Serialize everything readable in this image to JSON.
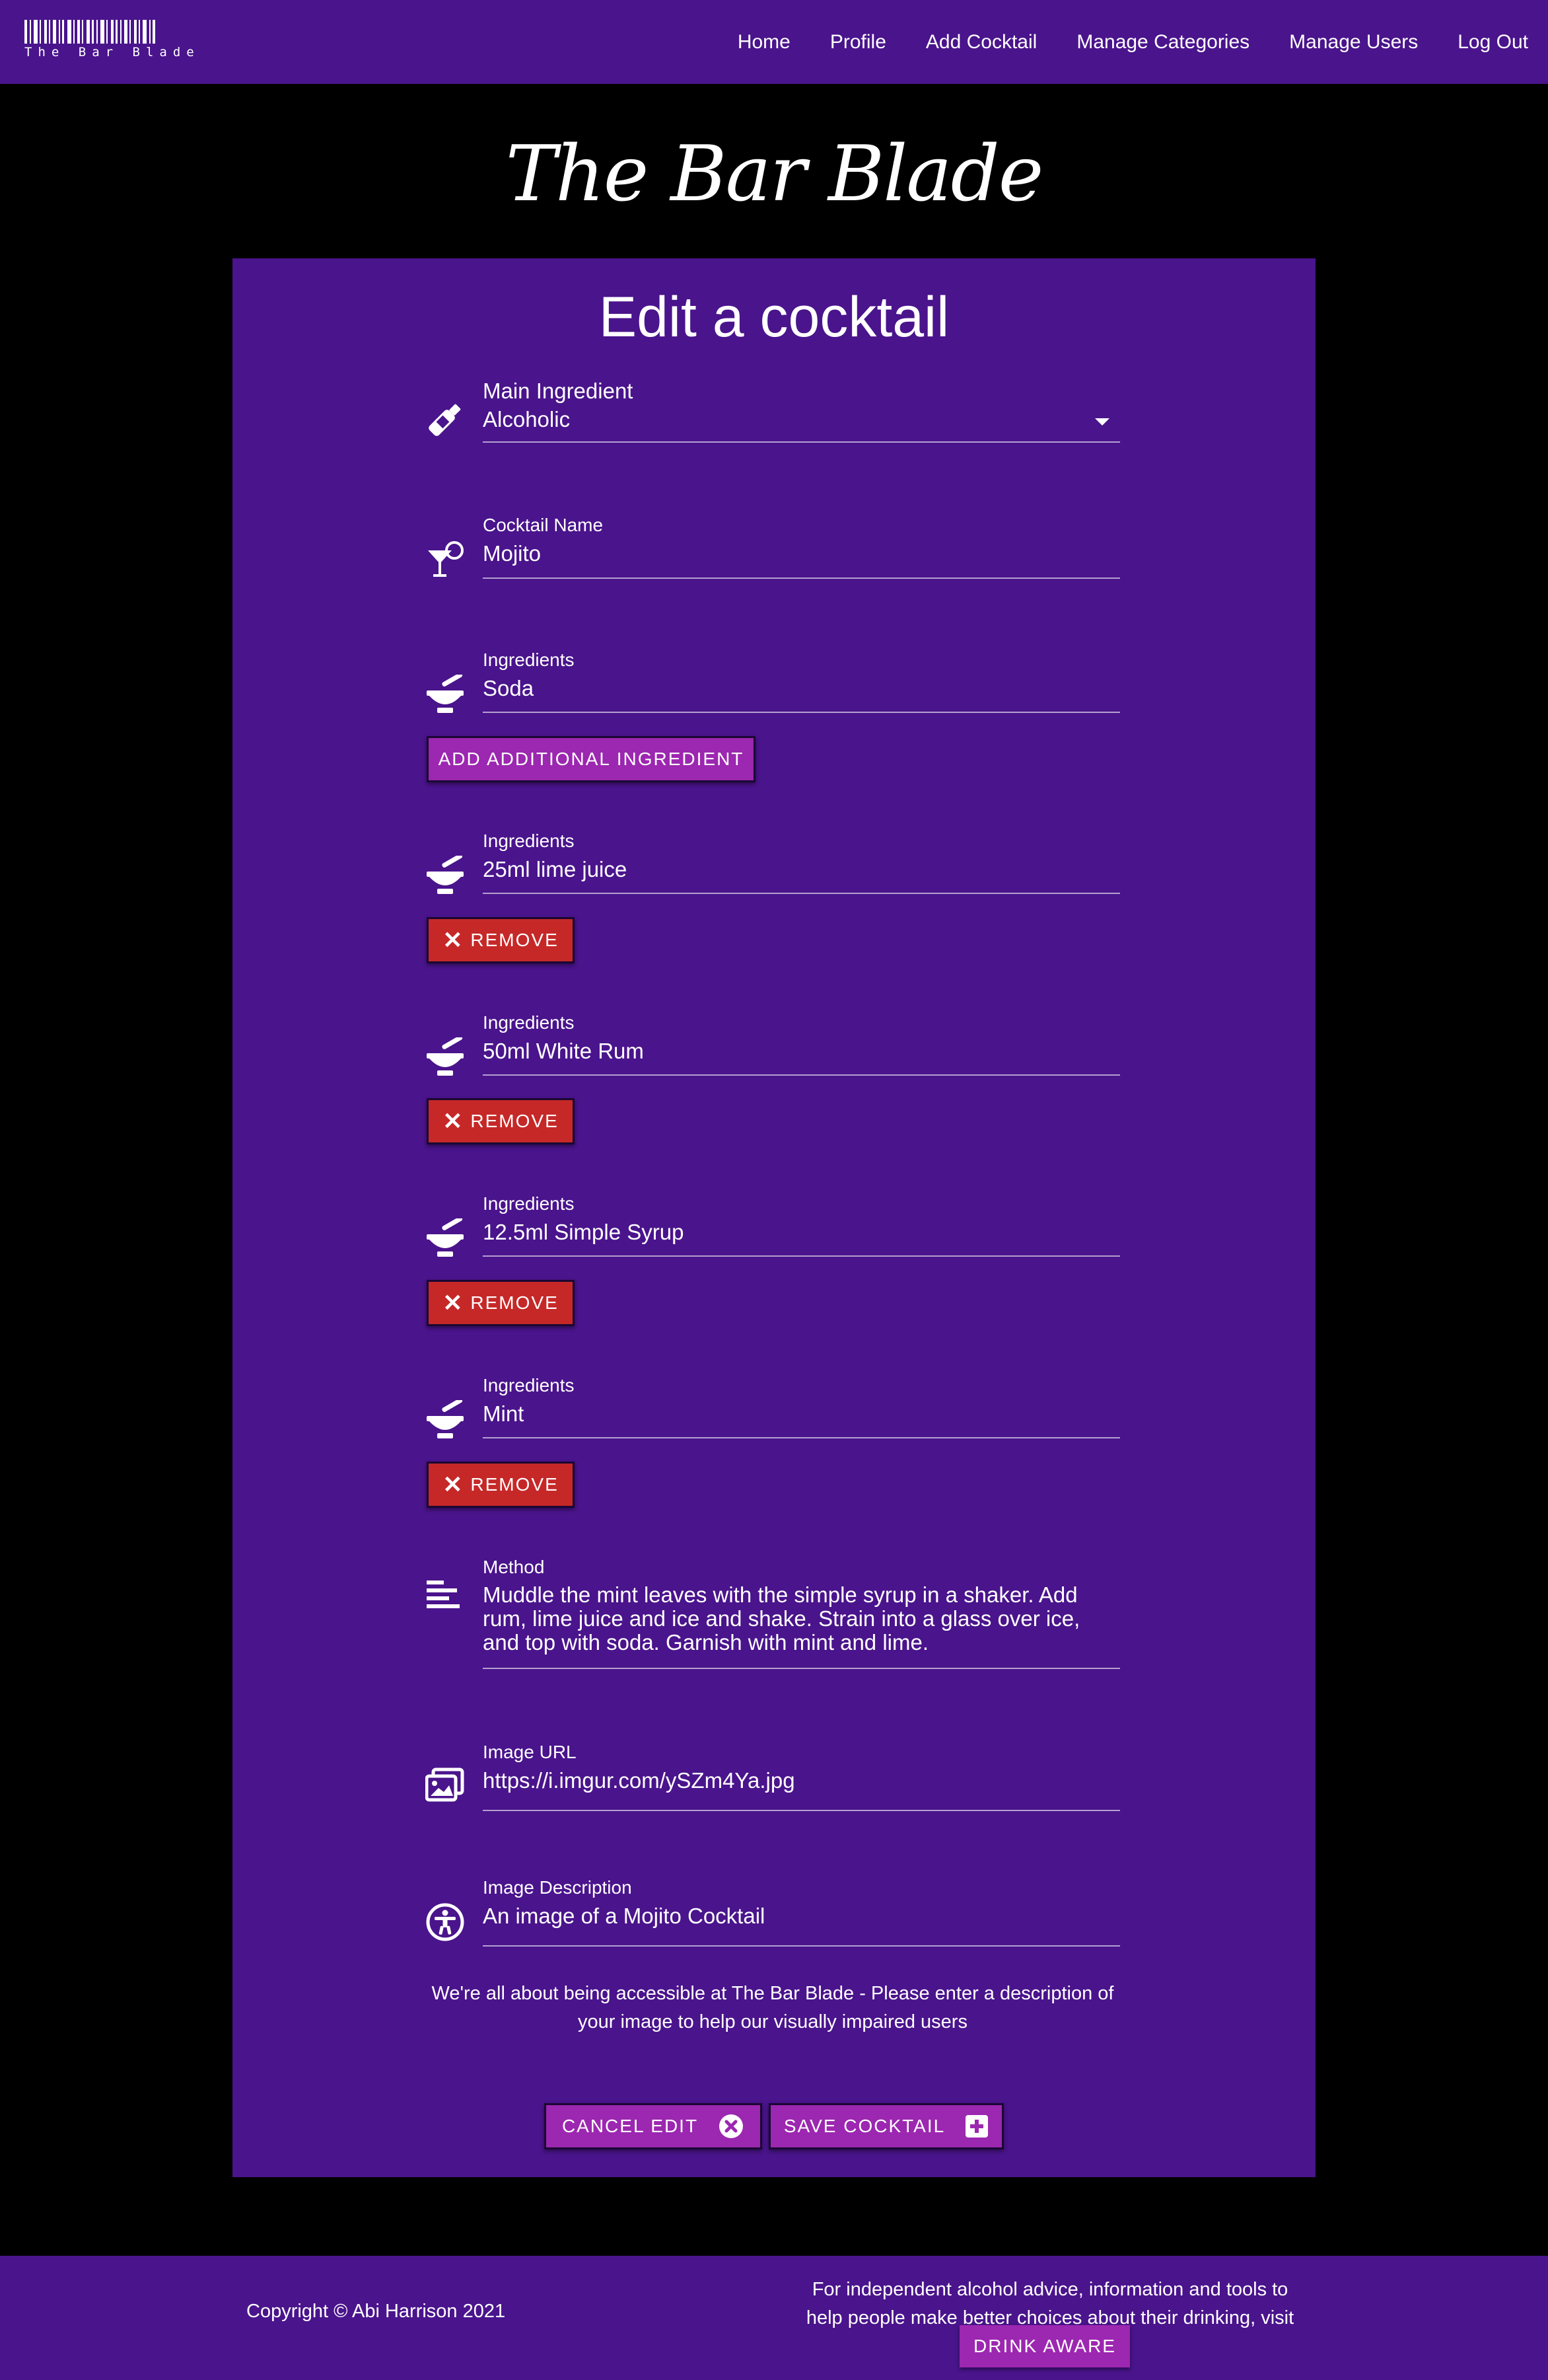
{
  "nav": {
    "logo_text": "The Bar Blade",
    "links": [
      "Home",
      "Profile",
      "Add Cocktail",
      "Manage Categories",
      "Manage Users",
      "Log Out"
    ]
  },
  "site_title": "The Bar Blade",
  "form": {
    "title": "Edit a cocktail",
    "main_ingredient": {
      "label": "Main Ingredient",
      "value": "Alcoholic"
    },
    "cocktail_name": {
      "label": "Cocktail Name",
      "value": "Mojito"
    },
    "first_ingredient": {
      "label": "Ingredients",
      "value": "Soda"
    },
    "add_ingredient_label": "ADD ADDITIONAL INGREDIENT",
    "ingredients": [
      {
        "label": "Ingredients",
        "value": "25ml lime juice",
        "remove_label": "REMOVE"
      },
      {
        "label": "Ingredients",
        "value": "50ml White Rum",
        "remove_label": "REMOVE"
      },
      {
        "label": "Ingredients",
        "value": "12.5ml Simple Syrup",
        "remove_label": "REMOVE"
      },
      {
        "label": "Ingredients",
        "value": "Mint",
        "remove_label": "REMOVE"
      }
    ],
    "method": {
      "label": "Method",
      "value": "Muddle the mint leaves with the simple syrup in a shaker. Add rum, lime juice and ice and shake. Strain into a glass over ice, and top with soda. Garnish with mint and lime."
    },
    "image_url": {
      "label": "Image URL",
      "value": "https://i.imgur.com/ySZm4Ya.jpg"
    },
    "image_description": {
      "label": "Image Description",
      "value": "An image of a Mojito Cocktail"
    },
    "accessibility_note": "We're all about being accessible at The Bar Blade - Please enter a description of your image to help our visually impaired users",
    "cancel_label": "CANCEL EDIT",
    "save_label": "SAVE COCKTAIL"
  },
  "footer": {
    "copyright": "Copyright © Abi Harrison 2021",
    "advice": "For independent alcohol advice, information and tools to help people make better choices about their drinking, visit",
    "drink_aware_label": "DRINK AWARE"
  },
  "colors": {
    "primary": "#4a148c",
    "button_purple": "#9c27b0",
    "button_red": "#c62828",
    "background": "#000000"
  }
}
